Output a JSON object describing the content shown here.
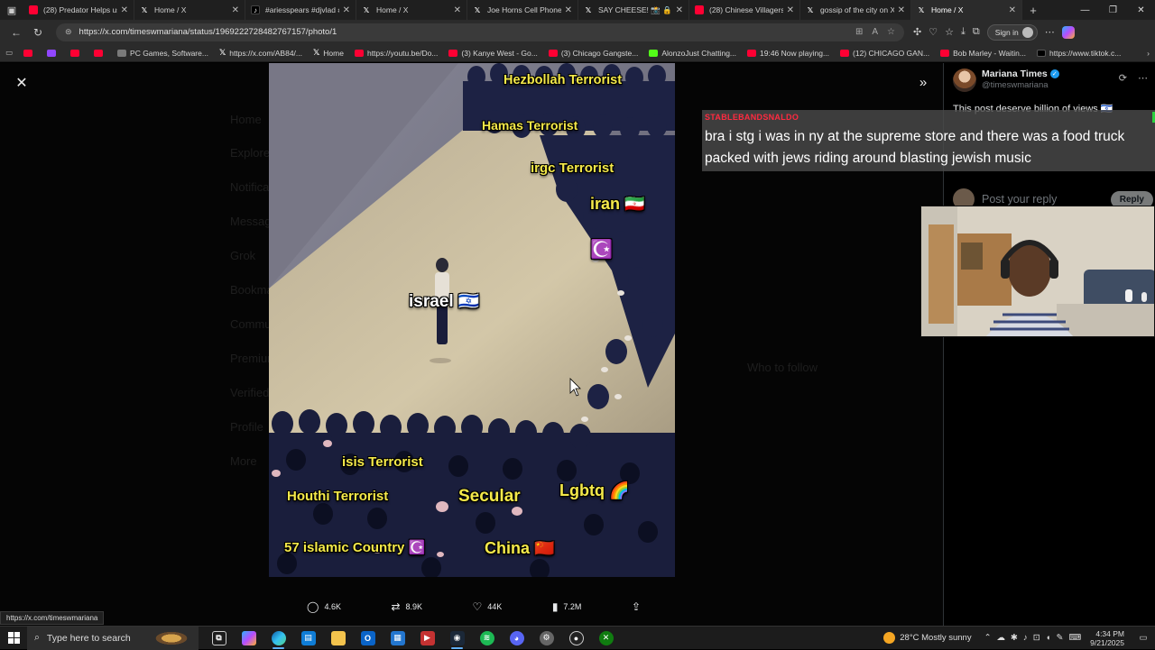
{
  "browser": {
    "tabs": [
      {
        "title": "(28) Predator Helps us",
        "icon": "youtube-icon",
        "active": false
      },
      {
        "title": "Home / X",
        "icon": "x-icon",
        "active": false
      },
      {
        "title": "#ariesspears #djvlad #",
        "icon": "tiktok-icon",
        "active": false
      },
      {
        "title": "Home / X",
        "icon": "x-icon",
        "active": false
      },
      {
        "title": "Joe Horns Cell Phone c",
        "icon": "x-icon",
        "active": false
      },
      {
        "title": "SAY CHEESE! 📸 🔒 on",
        "icon": "x-icon",
        "active": false
      },
      {
        "title": "(28) Chinese Villagers",
        "icon": "youtube-icon",
        "active": false
      },
      {
        "title": "gossip of the city on X",
        "icon": "x-icon",
        "active": false
      },
      {
        "title": "Home / X",
        "icon": "x-icon",
        "active": true
      }
    ],
    "url": "https://x.com/timeswmariana/status/1969222728482767157/photo/1",
    "signin_label": "Sign in",
    "bookmarks": [
      {
        "label": "",
        "icon": "yt"
      },
      {
        "label": "",
        "icon": "tw"
      },
      {
        "label": "",
        "icon": "yt"
      },
      {
        "label": "",
        "icon": "yt"
      },
      {
        "label": "PC Games, Software...",
        "icon": "gen"
      },
      {
        "label": "https://x.com/AB84/...",
        "icon": "x"
      },
      {
        "label": "Home",
        "icon": "x"
      },
      {
        "label": "https://youtu.be/Do...",
        "icon": "yt"
      },
      {
        "label": "(3) Kanye West - Go...",
        "icon": "yt"
      },
      {
        "label": "(3) Chicago Gangste...",
        "icon": "yt"
      },
      {
        "label": "AlonzoJust Chatting...",
        "icon": "kick"
      },
      {
        "label": "19:46 Now playing...",
        "icon": "yt"
      },
      {
        "label": "(12) CHICAGO GAN...",
        "icon": "yt"
      },
      {
        "label": "Bob Marley - Waitin...",
        "icon": "yt"
      },
      {
        "label": "https://www.tiktok.c...",
        "icon": "tt"
      }
    ]
  },
  "media": {
    "labels": {
      "hezbollah": "Hezbollah Terrorist",
      "hamas": "Hamas Terrorist",
      "irgc": "irgc Terrorist",
      "iran": "iran 🇮🇷",
      "crescent": "☪️",
      "israel": "israel 🇮🇱",
      "isis": "isis Terrorist",
      "houthi": "Houthi Terrorist",
      "secular": "Secular",
      "lgbtq": "Lgbtq 🌈",
      "islamic": "57 islamic Country ☪️",
      "china": "China 🇨🇳"
    }
  },
  "post_actions": {
    "replies": "4.6K",
    "reposts": "8.9K",
    "likes": "44K",
    "views": "7.2M"
  },
  "sidebar": {
    "author_name": "Mariana Times",
    "author_handle": "@timeswmariana",
    "post_text": "This post deserve billion of views 🇮🇱",
    "reply_placeholder": "Post your reply",
    "reply_button": "Reply"
  },
  "chat": {
    "username": "STABLEBANDSNALDO",
    "message": "bra i stg i was in ny at the supreme store and there was a food truck packed with jews riding around blasting jewish music"
  },
  "status_url": "https://x.com/timeswmariana",
  "taskbar": {
    "search_placeholder": "Type here to search",
    "weather": "28°C  Mostly sunny",
    "time": "4:34 PM",
    "date": "9/21/2025"
  },
  "colors": {
    "label_yellow": "#f4e94a",
    "chat_user_red": "#ff2a40",
    "x_blue": "#1d9bf0"
  }
}
